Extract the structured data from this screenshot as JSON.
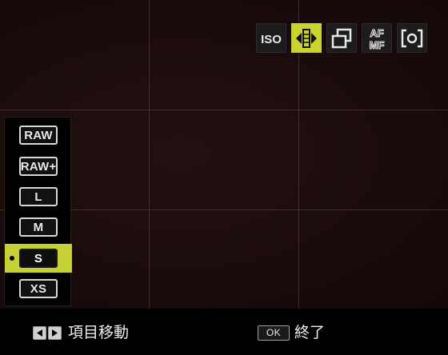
{
  "function_icons": [
    {
      "name": "iso-icon",
      "label": "ISO",
      "selected": false
    },
    {
      "name": "image-size-icon",
      "label": "",
      "selected": true
    },
    {
      "name": "drive-mode-icon",
      "label": "",
      "selected": false
    },
    {
      "name": "af-mf-icon",
      "label": "",
      "selected": false
    },
    {
      "name": "metering-icon",
      "label": "",
      "selected": false
    }
  ],
  "size_menu": {
    "items": [
      {
        "label": "RAW",
        "selected": false
      },
      {
        "label": "RAW+",
        "selected": false
      },
      {
        "label": "L",
        "selected": false
      },
      {
        "label": "M",
        "selected": false
      },
      {
        "label": "S",
        "selected": true
      },
      {
        "label": "XS",
        "selected": false
      }
    ],
    "selected_value": "S"
  },
  "bottom_bar": {
    "nav_label": "項目移動",
    "ok_key": "OK",
    "ok_label": "終了"
  },
  "colors": {
    "accent": "#c9d42e",
    "background": "#1b0c0c"
  }
}
